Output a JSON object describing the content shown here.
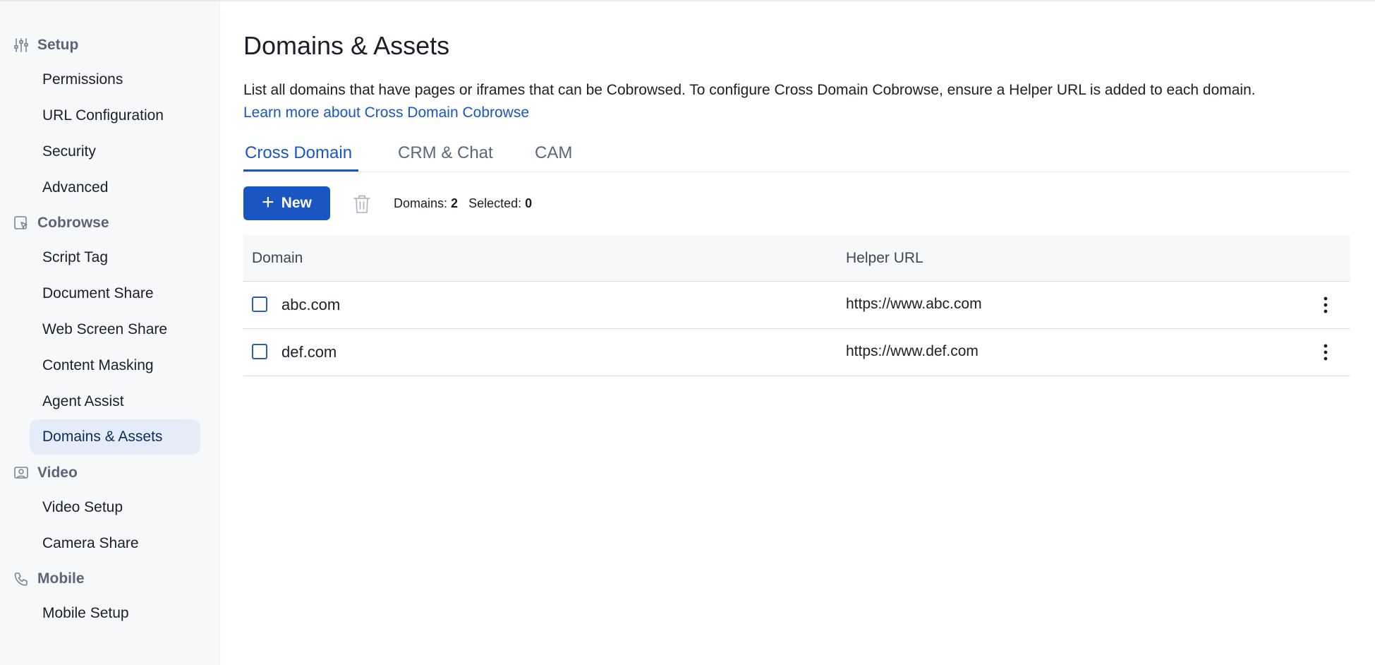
{
  "sidebar": {
    "sections": [
      {
        "label": "Setup",
        "icon": "sliders-icon",
        "items": [
          "Permissions",
          "URL Configuration",
          "Security",
          "Advanced"
        ]
      },
      {
        "label": "Cobrowse",
        "icon": "cobrowse-icon",
        "items": [
          "Script Tag",
          "Document Share",
          "Web Screen Share",
          "Content Masking",
          "Agent Assist",
          "Domains & Assets"
        ]
      },
      {
        "label": "Video",
        "icon": "video-person-icon",
        "items": [
          "Video Setup",
          "Camera Share"
        ]
      },
      {
        "label": "Mobile",
        "icon": "phone-icon",
        "items": [
          "Mobile Setup"
        ]
      }
    ],
    "active_item": "Domains & Assets"
  },
  "main": {
    "title": "Domains & Assets",
    "description": "List all domains that have pages or iframes that can be Cobrowsed. To configure Cross Domain Cobrowse, ensure a Helper URL is added to each domain.",
    "learn_more": "Learn more about Cross Domain Cobrowse",
    "tabs": [
      "Cross Domain",
      "CRM & Chat",
      "CAM"
    ],
    "active_tab": "Cross Domain",
    "toolbar": {
      "new_label": "New",
      "domains_label": "Domains:",
      "domains_count": "2",
      "selected_label": "Selected:",
      "selected_count": "0"
    },
    "table": {
      "columns": [
        "Domain",
        "Helper URL"
      ],
      "rows": [
        {
          "domain": "abc.com",
          "helper_url": "https://www.abc.com",
          "checked": false
        },
        {
          "domain": "def.com",
          "helper_url": "https://www.def.com",
          "checked": false
        }
      ]
    }
  },
  "colors": {
    "accent": "#1a56c2",
    "sidebar_bg": "#f7f8fa",
    "active_item_bg": "#e4ecf8"
  }
}
